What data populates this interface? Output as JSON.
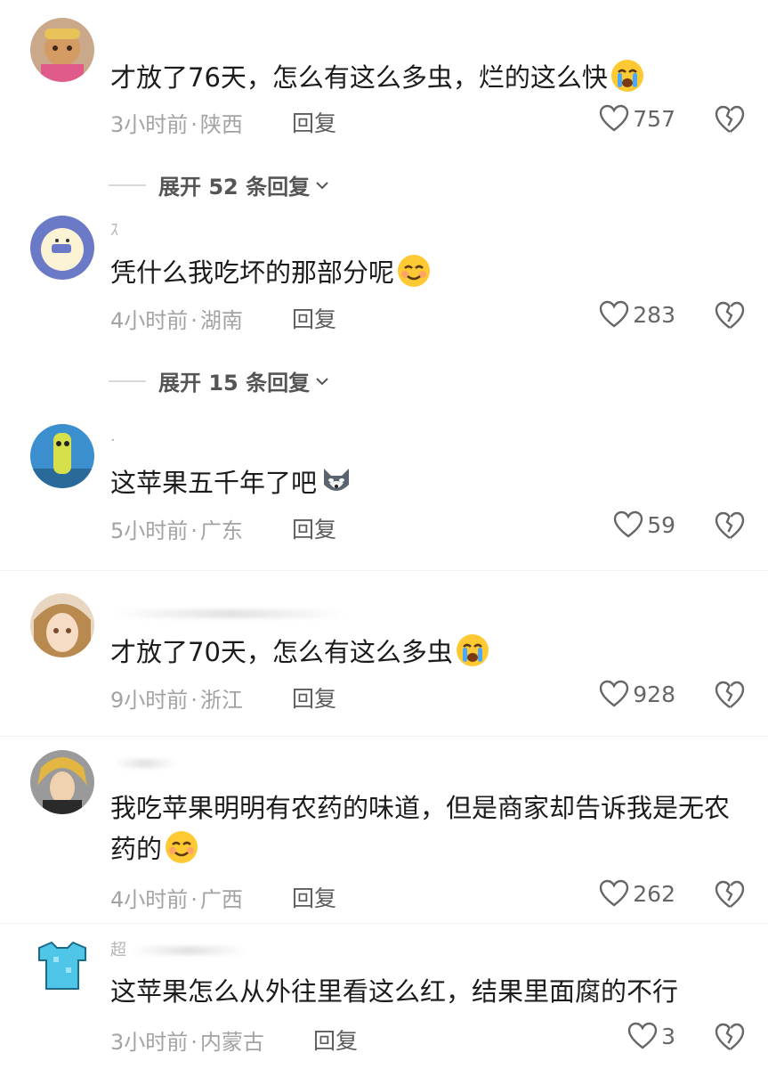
{
  "comments": [
    {
      "username": "",
      "text": "才放了76天，怎么有这么多虫，烂的这么快",
      "emoji": "crying-face-icon",
      "time": "3小时前",
      "location": "陕西",
      "reply": "回复",
      "likes": "757",
      "expand": "展开 52 条回复"
    },
    {
      "username": "ｽ",
      "text": "凭什么我吃坏的那部分呢",
      "emoji": "smiling-face-icon",
      "time": "4小时前",
      "location": "湖南",
      "reply": "回复",
      "likes": "283",
      "expand": "展开 15 条回复"
    },
    {
      "username": "·",
      "text": "这苹果五千年了吧",
      "emoji": "husky-dog-icon",
      "time": "5小时前",
      "location": "广东",
      "reply": "回复",
      "likes": "59"
    },
    {
      "username": "",
      "text": "才放了70天，怎么有这么多虫",
      "emoji": "crying-face-icon",
      "time": "9小时前",
      "location": "浙江",
      "reply": "回复",
      "likes": "928"
    },
    {
      "username": "",
      "text": "我吃苹果明明有农药的味道，但是商家却告诉我是无农药的",
      "emoji": "smiling-face-icon",
      "time": "4小时前",
      "location": "广西",
      "reply": "回复",
      "likes": "262"
    },
    {
      "username": "超",
      "text": "这苹果怎么从外往里看这么红，结果里面腐的不行",
      "emoji": "",
      "time": "3小时前",
      "location": "内蒙古",
      "reply": "回复",
      "likes": "3"
    }
  ],
  "separator": "·",
  "colors": {
    "meta": "#a3a3a3",
    "reply": "#5c5c5c",
    "text": "#1c1c1c"
  }
}
